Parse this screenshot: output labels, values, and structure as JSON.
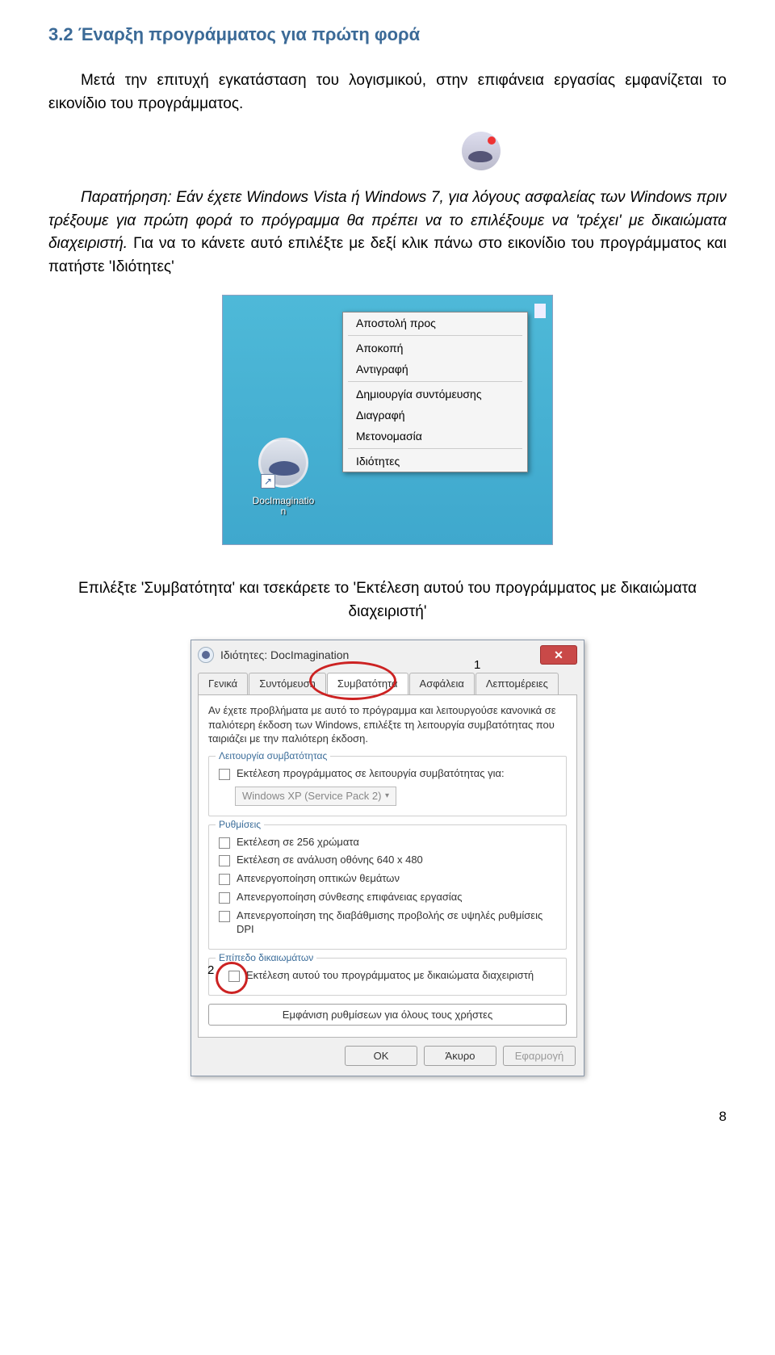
{
  "heading": "3.2 Έναρξη προγράμματος για πρώτη φορά",
  "para1": "Μετά την επιτυχή εγκατάσταση του λογισμικού, στην επιφάνεια εργασίας εμφανίζεται το εικονίδιο του προγράμματος.",
  "para2_italic": "Παρατήρηση: Εάν έχετε Windows Vista ή Windows 7, για λόγους ασφαλείας των Windows πριν τρέξουμε για πρώτη φορά το πρόγραμμα θα πρέπει να το επιλέξουμε να 'τρέχει' με δικαιώματα διαχειριστή.",
  "para2_tail": " Για να το κάνετε αυτό επιλέξτε με δεξί κλικ πάνω στο εικονίδιο του προγράμματος και πατήστε 'Ιδιότητες'",
  "context_menu": {
    "m1": "Αποστολή προς",
    "m2": "Αποκοπή",
    "m3": "Αντιγραφή",
    "m4": "Δημιουργία συντόμευσης",
    "m5": "Διαγραφή",
    "m6": "Μετονομασία",
    "m7": "Ιδιότητες"
  },
  "desktop_icon": {
    "name": "DocImaginatio",
    "name2": "n"
  },
  "between": "Επιλέξτε 'Συμβατότητα' και τσεκάρετε το 'Εκτέλεση αυτού του προγράμματος με δικαιώματα διαχειριστή'",
  "dialog": {
    "title": "Ιδιότητες: DocImagination",
    "tabs": {
      "t1": "Γενικά",
      "t2": "Συντόμευση",
      "t3": "Συμβατότητα",
      "t4": "Ασφάλεια",
      "t5": "Λεπτομέρειες"
    },
    "num1": "1",
    "num2": "2",
    "desc": "Αν έχετε προβλήματα με αυτό το πρόγραμμα και λειτουργούσε κανονικά σε παλιότερη έκδοση των Windows, επιλέξτε τη λειτουργία συμβατότητας που ταιριάζει με την παλιότερη έκδοση.",
    "g1_legend": "Λειτουργία συμβατότητας",
    "g1_chk": "Εκτέλεση προγράμματος σε λειτουργία συμβατότητας για:",
    "g1_sel": "Windows XP (Service Pack 2)",
    "g2_legend": "Ρυθμίσεις",
    "g2_c1": "Εκτέλεση σε 256 χρώματα",
    "g2_c2": "Εκτέλεση σε ανάλυση οθόνης 640 x 480",
    "g2_c3": "Απενεργοποίηση οπτικών θεμάτων",
    "g2_c4": "Απενεργοποίηση σύνθεσης επιφάνειας εργασίας",
    "g2_c5": "Απενεργοποίηση της διαβάθμισης προβολής σε υψηλές ρυθμίσεις DPI",
    "g3_legend": "Επίπεδο δικαιωμάτων",
    "g3_c1": "Εκτέλεση αυτού του προγράμματος με δικαιώματα διαχειριστή",
    "wide_btn": "Εμφάνιση ρυθμίσεων για όλους τους χρήστες",
    "ok": "OK",
    "cancel": "Άκυρο",
    "apply": "Εφαρμογή"
  },
  "page_no": "8"
}
